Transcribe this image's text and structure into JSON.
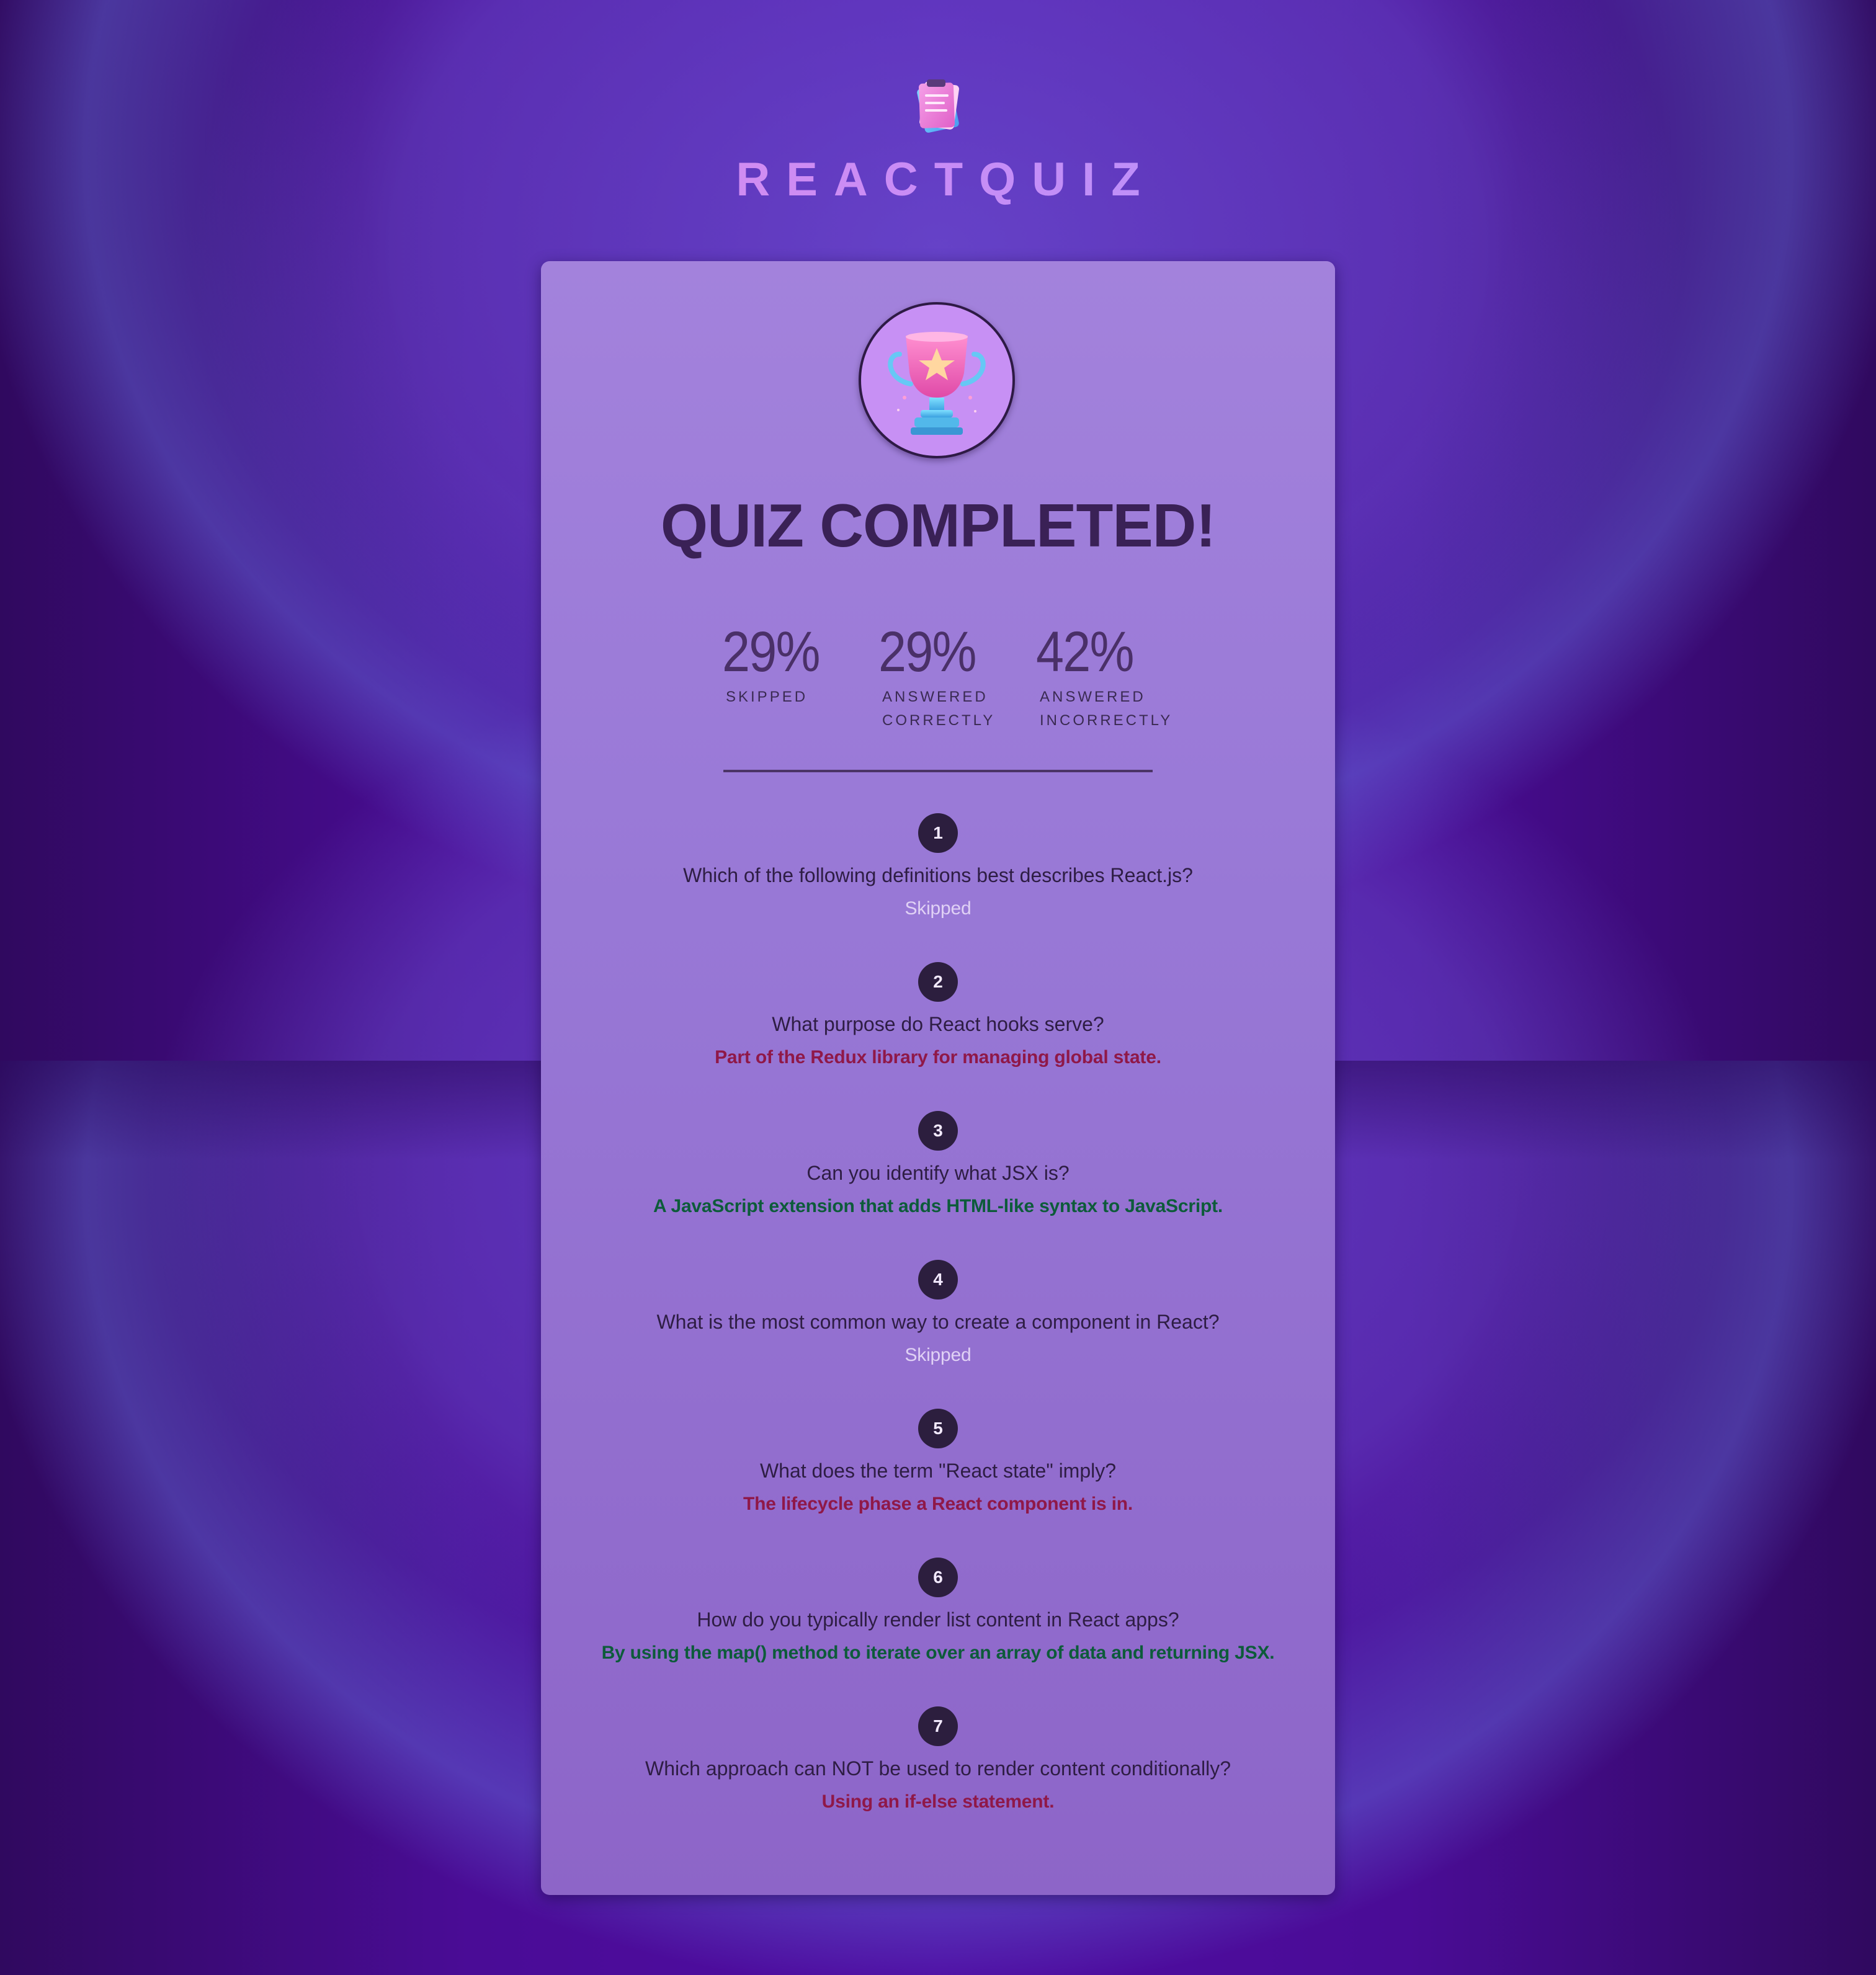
{
  "app": {
    "title": "REACTQUIZ"
  },
  "summary": {
    "title": "QUIZ COMPLETED!",
    "stats": [
      {
        "value": "29%",
        "label": "SKIPPED"
      },
      {
        "value": "29%",
        "label": "ANSWERED\nCORRECTLY"
      },
      {
        "value": "42%",
        "label": "ANSWERED\nINCORRECTLY"
      }
    ]
  },
  "answers": [
    {
      "number": "1",
      "question": "Which of the following definitions best describes React.js?",
      "answer": "Skipped",
      "status": "skipped"
    },
    {
      "number": "2",
      "question": "What purpose do React hooks serve?",
      "answer": "Part of the Redux library for managing global state.",
      "status": "wrong"
    },
    {
      "number": "3",
      "question": "Can you identify what JSX is?",
      "answer": "A JavaScript extension that adds HTML-like syntax to JavaScript.",
      "status": "correct"
    },
    {
      "number": "4",
      "question": "What is the most common way to create a component in React?",
      "answer": "Skipped",
      "status": "skipped"
    },
    {
      "number": "5",
      "question": "What does the term \"React state\" imply?",
      "answer": "The lifecycle phase a React component is in.",
      "status": "wrong"
    },
    {
      "number": "6",
      "question": "How do you typically render list content in React apps?",
      "answer": "By using the map() method to iterate over an array of data and returning JSX.",
      "status": "correct"
    },
    {
      "number": "7",
      "question": "Which approach can NOT be used to render content conditionally?",
      "answer": "Using an if-else statement.",
      "status": "wrong"
    }
  ],
  "colors": {
    "correct": "#0d5b3a",
    "wrong": "#8f1848",
    "skipped": "#e0d1f5",
    "card": "#9878d6",
    "background": "#4f0ca2"
  },
  "icons": {
    "logo": "quiz-papers-icon",
    "trophy": "trophy-icon"
  }
}
